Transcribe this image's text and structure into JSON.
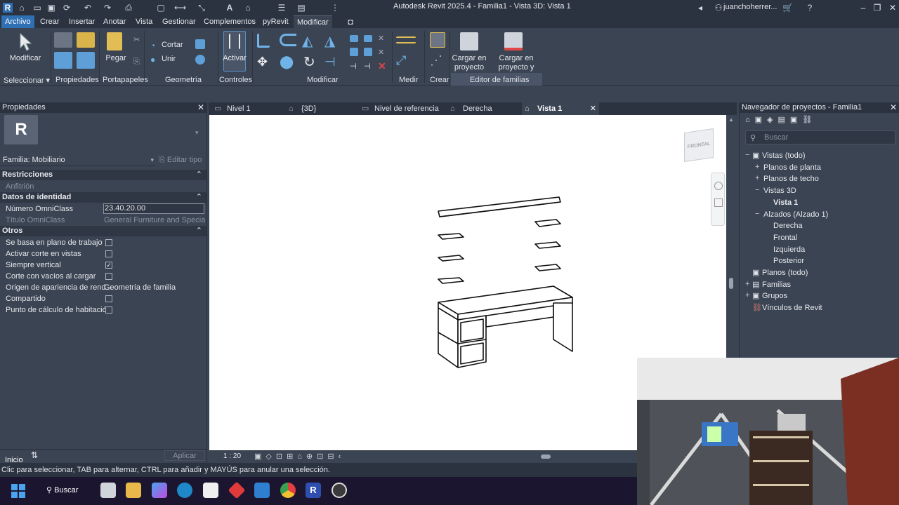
{
  "titlebar": {
    "title": "Autodesk Revit 2025.4 - Familia1 - Vista 3D: Vista 1",
    "user": "juanchoherrer..."
  },
  "menu": {
    "tabs": [
      "Archivo",
      "Crear",
      "Insertar",
      "Anotar",
      "Vista",
      "Gestionar",
      "Complementos",
      "pyRevit",
      "Modificar"
    ]
  },
  "ribbon": {
    "modificar": "Modificar",
    "pegar": "Pegar",
    "cortar": "Cortar",
    "unir": "Unir",
    "activar": "Activar",
    "cargar_proyecto": "Cargar en proyecto",
    "cargar_cerrar": "Cargar en proyecto y cerrar",
    "panels": {
      "seleccionar": "Seleccionar",
      "propiedades": "Propiedades",
      "portapapeles": "Portapapeles",
      "geometria": "Geometría",
      "controles": "Controles",
      "modificar": "Modificar",
      "medir": "Medir",
      "crear": "Crear",
      "editor": "Editor de familias"
    }
  },
  "properties": {
    "header": "Propiedades",
    "family_selector": "Familia: Mobiliario",
    "edit_type": "Editar tipo",
    "sections": {
      "restricciones": "Restricciones",
      "identidad": "Datos de identidad",
      "otros": "Otros"
    },
    "anfitrion": "Anfitrión",
    "omni_num_label": "Número OmniClass",
    "omni_num_value": "23.40.20.00",
    "omni_title_label": "Título OmniClass",
    "omni_title_value": "General Furniture and Specialti...",
    "otros": [
      {
        "label": "Se basa en plano de trabajo",
        "checked": false
      },
      {
        "label": "Activar corte en vistas",
        "checked": false
      },
      {
        "label": "Siempre vertical",
        "checked": true
      },
      {
        "label": "Corte con vacíos al cargar",
        "checked": false
      },
      {
        "label": "Origen de apariencia de rend...",
        "value": "Geometría de familia"
      },
      {
        "label": "Compartido",
        "checked": false
      },
      {
        "label": "Punto de cálculo de habitación",
        "checked": false
      }
    ],
    "apply": "Aplicar",
    "inicio": "Inicio"
  },
  "views": {
    "tabs": [
      "Nivel 1",
      "{3D}",
      "Nivel de referencia",
      "Derecha",
      "Vista 1"
    ],
    "active": "Vista 1",
    "scale": "1 : 20",
    "viewcube": "FRONTAL"
  },
  "browser": {
    "header": "Navegador de proyectos - Familia1",
    "search_placeholder": "Buscar",
    "nodes": [
      {
        "label": "Vistas (todo)",
        "sign": "−"
      },
      {
        "label": "Planos de planta",
        "sign": "+"
      },
      {
        "label": "Planos de techo",
        "sign": "+"
      },
      {
        "label": "Vistas 3D",
        "sign": "−"
      },
      {
        "label": "Vista 1",
        "sign": ""
      },
      {
        "label": "Alzados (Alzado 1)",
        "sign": "−"
      },
      {
        "label": "Derecha",
        "sign": ""
      },
      {
        "label": "Frontal",
        "sign": ""
      },
      {
        "label": "Izquierda",
        "sign": ""
      },
      {
        "label": "Posterior",
        "sign": ""
      },
      {
        "label": "Planos (todo)",
        "sign": ""
      },
      {
        "label": "Familias",
        "sign": "+"
      },
      {
        "label": "Grupos",
        "sign": "+"
      },
      {
        "label": "Vínculos de Revit",
        "sign": ""
      }
    ]
  },
  "status": {
    "text": "Clic para seleccionar, TAB para alternar, CTRL para añadir y MAYÚS para anular una selección."
  },
  "taskbar": {
    "search": "Buscar"
  },
  "colors": {
    "accent": "#2f6fb3",
    "panel": "#3b4453",
    "dark": "#2b3240"
  }
}
